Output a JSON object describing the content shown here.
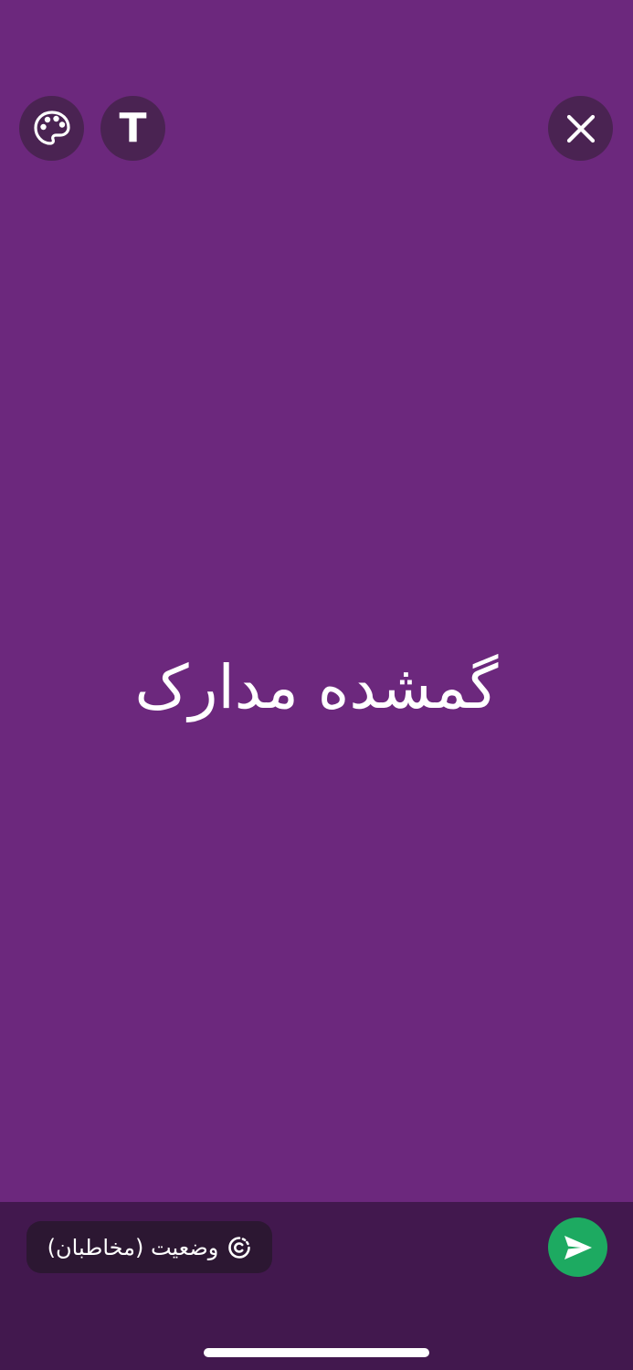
{
  "theme": {
    "canvas_color": "#6C287D",
    "bottom_bar_color": "#42184E",
    "button_color": "#4A2352",
    "chip_color": "#2C1732",
    "send_color": "#1DAA61"
  },
  "toolbar": {
    "palette_icon": "palette-icon",
    "text_button_label": "T",
    "close_icon": "close-icon"
  },
  "status": {
    "text": "گمشده مدارک"
  },
  "footer": {
    "audience_label": "وضعیت (مخاطبان)",
    "audience_icon": "status-ring-icon",
    "send_icon": "send-icon"
  }
}
